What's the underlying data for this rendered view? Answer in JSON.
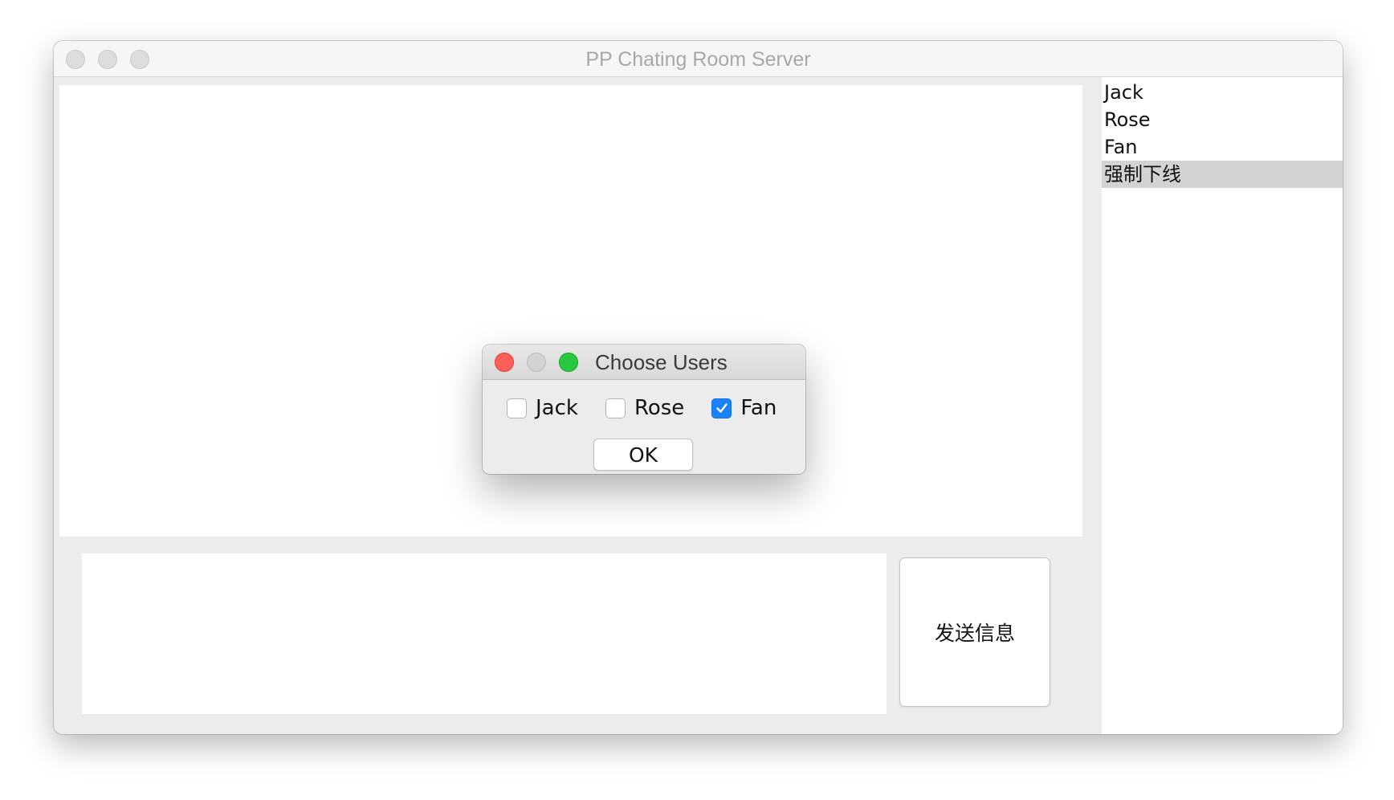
{
  "window": {
    "title": "PP Chating Room Server"
  },
  "users": {
    "items": [
      {
        "label": "Jack",
        "selected": false
      },
      {
        "label": "Rose",
        "selected": false
      },
      {
        "label": "Fan",
        "selected": false
      },
      {
        "label": "强制下线",
        "selected": true
      }
    ]
  },
  "compose": {
    "input_value": "",
    "send_label": "发送信息"
  },
  "dialog": {
    "title": "Choose Users",
    "options": [
      {
        "label": "Jack",
        "checked": false
      },
      {
        "label": "Rose",
        "checked": false
      },
      {
        "label": "Fan",
        "checked": true
      }
    ],
    "ok_label": "OK"
  },
  "colors": {
    "checkbox_checked": "#1a82fb",
    "close_button": "#fe5f57",
    "zoom_button": "#28c840",
    "selected_row": "#d3d3d3"
  }
}
